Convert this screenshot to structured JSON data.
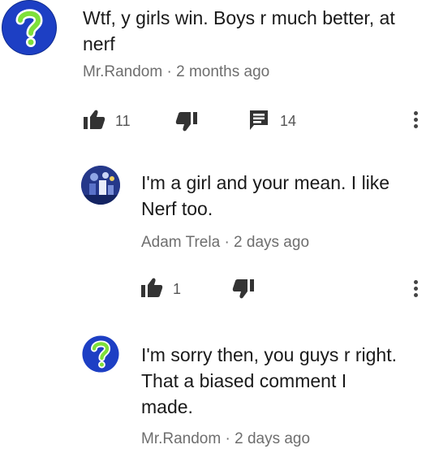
{
  "comments": [
    {
      "text": "Wtf, y girls win. Boys r much better, at\nnerf",
      "author": "Mr.Random",
      "separator": "·",
      "time": "2 months ago",
      "like_count": "11",
      "reply_count": "14"
    },
    {
      "text": "I'm a girl and your mean. I like\nNerf too.",
      "author": "Adam Trela",
      "separator": "·",
      "time": "2 days ago",
      "like_count": "1"
    },
    {
      "text": "I'm sorry then, you guys r right.\nThat a biased comment I\nmade.",
      "author": "Mr.Random",
      "separator": "·",
      "time": "2 days ago"
    }
  ],
  "colors": {
    "avatar_blue": "#1d3fc4",
    "question_mark_green": "#7ee03a",
    "text_primary": "#1a1a1a",
    "text_meta": "#6e6e6e",
    "icon_dark": "#333333"
  },
  "icons": {
    "like": "thumbs-up-icon",
    "dislike": "thumbs-down-icon",
    "reply": "comment-icon",
    "more": "more-vertical-icon",
    "avatar": "question-mark-icon"
  }
}
